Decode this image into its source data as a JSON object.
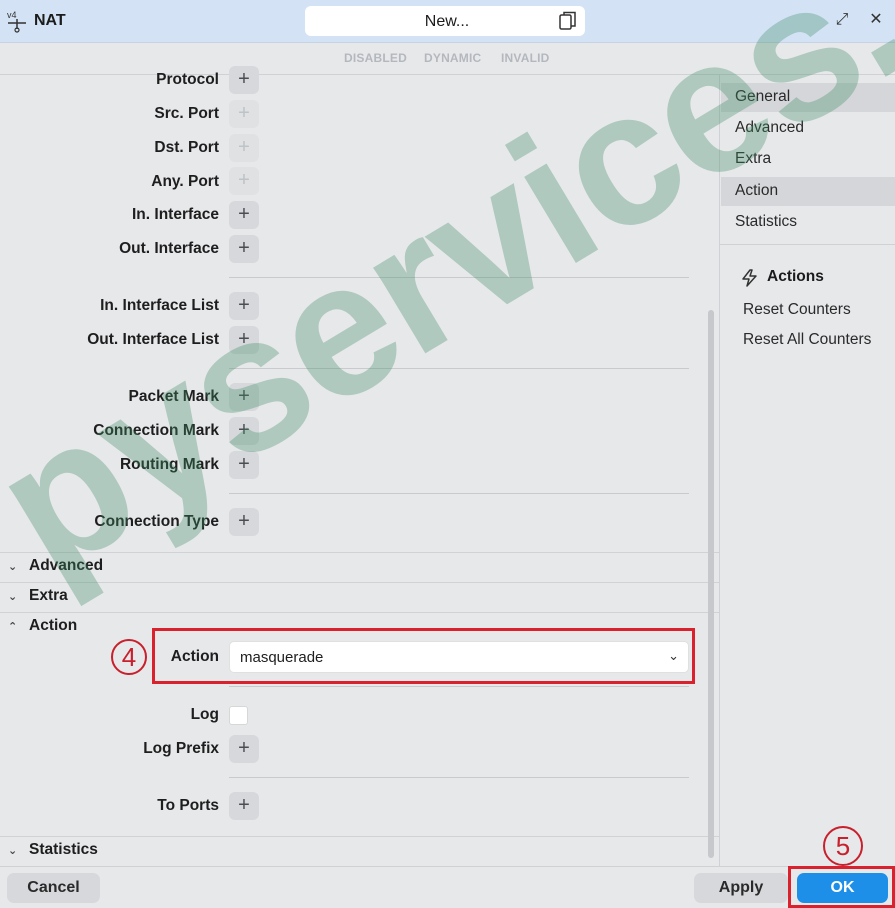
{
  "window": {
    "app_title": "NAT",
    "app_icon": "nat-v4-icon",
    "name_value": "New...",
    "copy_icon": "copy-icon",
    "expand_icon": "expand-icon",
    "close_icon": "close-icon"
  },
  "flags": [
    "DISABLED",
    "DYNAMIC",
    "INVALID"
  ],
  "general": {
    "protocol": "Protocol",
    "src_port": "Src. Port",
    "dst_port": "Dst. Port",
    "any_port": "Any. Port",
    "in_interface": "In. Interface",
    "out_interface": "Out. Interface",
    "in_interface_list": "In. Interface List",
    "out_interface_list": "Out. Interface List",
    "packet_mark": "Packet Mark",
    "connection_mark": "Connection Mark",
    "routing_mark": "Routing Mark",
    "connection_type": "Connection Type"
  },
  "sections": {
    "advanced": "Advanced",
    "extra": "Extra",
    "action": "Action",
    "statistics": "Statistics"
  },
  "action_section": {
    "action_label": "Action",
    "action_value": "masquerade",
    "log_label": "Log",
    "log_checked": false,
    "log_prefix": "Log Prefix",
    "to_ports": "To Ports"
  },
  "annotations": {
    "step4": "4",
    "step5": "5",
    "color": "#d9222e"
  },
  "side_nav": [
    {
      "label": "General",
      "highlighted": true
    },
    {
      "label": "Advanced",
      "highlighted": false
    },
    {
      "label": "Extra",
      "highlighted": false
    },
    {
      "label": "Action",
      "highlighted": true
    },
    {
      "label": "Statistics",
      "highlighted": false
    }
  ],
  "actions_panel": {
    "title": "Actions",
    "reset_counters": "Reset Counters",
    "reset_all_counters": "Reset All Counters"
  },
  "footer": {
    "cancel": "Cancel",
    "apply": "Apply",
    "ok": "OK"
  },
  "watermark": "pyservices.v",
  "colors": {
    "accent": "#1e8fe8",
    "titlebar": "#d3e3f5",
    "background": "#e7e8ea"
  }
}
